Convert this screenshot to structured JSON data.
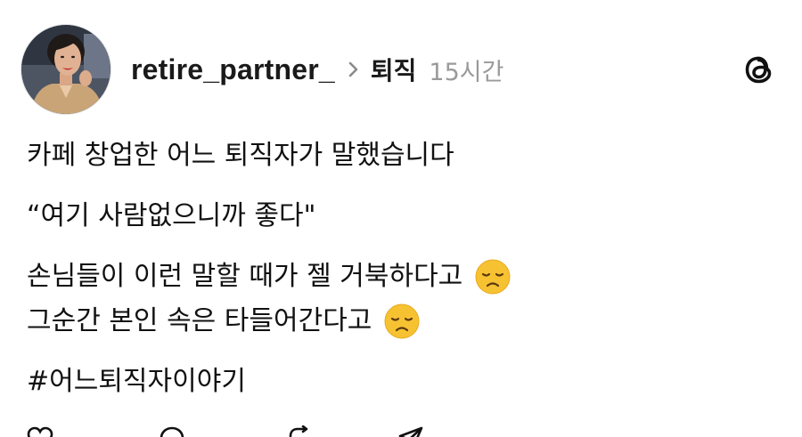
{
  "post": {
    "author": {
      "username": "retire_partner_",
      "avatar_icon": "profile-photo"
    },
    "topic": "퇴직",
    "time": "15시간",
    "app_icon": "threads-logo-icon",
    "lines": [
      "카페 창업한 어느 퇴직자가 말했습니다",
      "“여기 사람없으니까 좋다\"",
      "손님들이 이런 말할 때가 젤 거북하다고",
      "그순간 본인 속은 타들어간다고",
      "#어느퇴직자이야기"
    ],
    "emoji": "disappointed-face-emoji"
  },
  "actions": {
    "icons": [
      "heart-icon",
      "comment-icon",
      "repost-icon",
      "share-icon"
    ]
  },
  "colors": {
    "text": "#111111",
    "muted": "#9a9a9a",
    "emoji": "#f7c232",
    "background": "#ffffff"
  }
}
